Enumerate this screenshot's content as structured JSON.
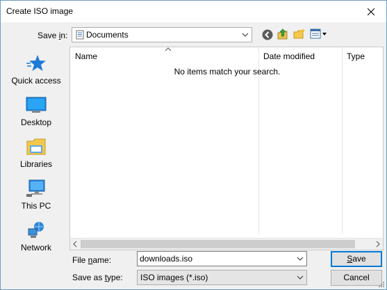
{
  "window": {
    "title": "Create ISO image"
  },
  "location": {
    "label_pre": "Save ",
    "label_key": "i",
    "label_post": "n:",
    "value": "Documents"
  },
  "places": [
    {
      "label": "Quick access"
    },
    {
      "label": "Desktop"
    },
    {
      "label": "Libraries"
    },
    {
      "label": "This PC"
    },
    {
      "label": "Network"
    }
  ],
  "list": {
    "columns": [
      "Name",
      "Date modified",
      "Type"
    ],
    "empty_message": "No items match your search."
  },
  "filename": {
    "label_pre": "File ",
    "label_key": "n",
    "label_post": "ame:",
    "value": "downloads.iso"
  },
  "filetype": {
    "label_pre": "Save as ",
    "label_key": "t",
    "label_post": "ype:",
    "value": "ISO images (*.iso)"
  },
  "buttons": {
    "save_key": "S",
    "save_rest": "ave",
    "cancel": "Cancel"
  },
  "colors": {
    "accent": "#0078d7",
    "window_border": "#6b9ac8"
  }
}
